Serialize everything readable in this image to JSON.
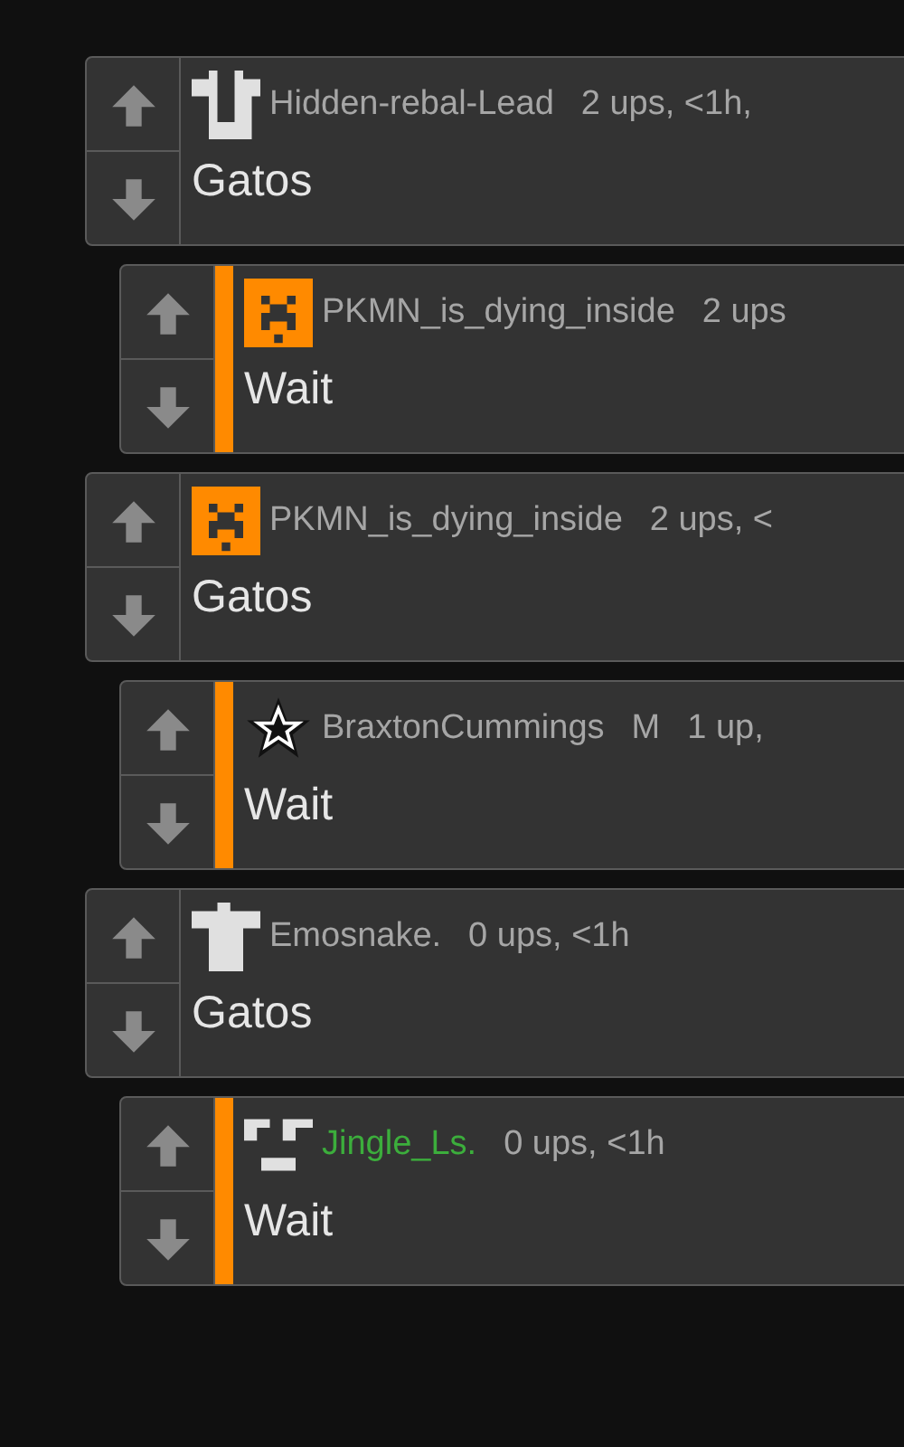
{
  "comments": [
    {
      "kind": "comment",
      "avatar": {
        "kind": "tee"
      },
      "username": "Hidden-rebal-Lead",
      "color": "#a6a6a6",
      "meta": "2 ups, <1h,",
      "text": "Gatos"
    },
    {
      "kind": "reply",
      "avatar": {
        "kind": "creeper"
      },
      "username": "PKMN_is_dying_inside",
      "color": "#a6a6a6",
      "meta": "2 ups",
      "text": "Wait"
    },
    {
      "kind": "comment",
      "avatar": {
        "kind": "creeper"
      },
      "username": "PKMN_is_dying_inside",
      "color": "#a6a6a6",
      "meta": "2 ups, <",
      "text": "Gatos"
    },
    {
      "kind": "reply",
      "avatar": {
        "kind": "star"
      },
      "username": "BraxtonCummings",
      "color": "#a6a6a6",
      "badge": "M",
      "meta": "1 up,",
      "text": "Wait"
    },
    {
      "kind": "comment",
      "avatar": {
        "kind": "cross"
      },
      "username": "Emosnake.",
      "color": "#a6a6a6",
      "meta": "0 ups, <1h",
      "text": "Gatos"
    },
    {
      "kind": "reply",
      "avatar": {
        "kind": "face"
      },
      "username": "Jingle_Ls.",
      "color": "#3cae3c",
      "meta": "0 ups, <1h",
      "text": "Wait"
    }
  ]
}
